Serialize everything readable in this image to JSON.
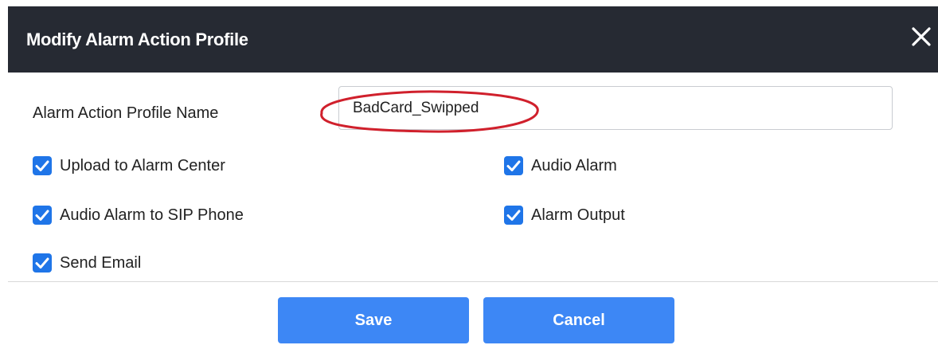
{
  "dialog": {
    "title": "Modify Alarm Action Profile",
    "close_icon": "close-icon"
  },
  "form": {
    "name_label": "Alarm Action Profile Name",
    "name_value": "BadCard_Swipped",
    "checkboxes": [
      {
        "label": "Upload to Alarm Center",
        "checked": true
      },
      {
        "label": "Audio Alarm",
        "checked": true
      },
      {
        "label": "Audio Alarm to SIP Phone",
        "checked": true
      },
      {
        "label": "Alarm Output",
        "checked": true
      },
      {
        "label": "Send Email",
        "checked": true
      }
    ]
  },
  "footer": {
    "save_label": "Save",
    "cancel_label": "Cancel"
  },
  "colors": {
    "header_bg": "#262a33",
    "accent": "#1f75e8",
    "button": "#3d87f5",
    "annotation": "#d0202c"
  }
}
